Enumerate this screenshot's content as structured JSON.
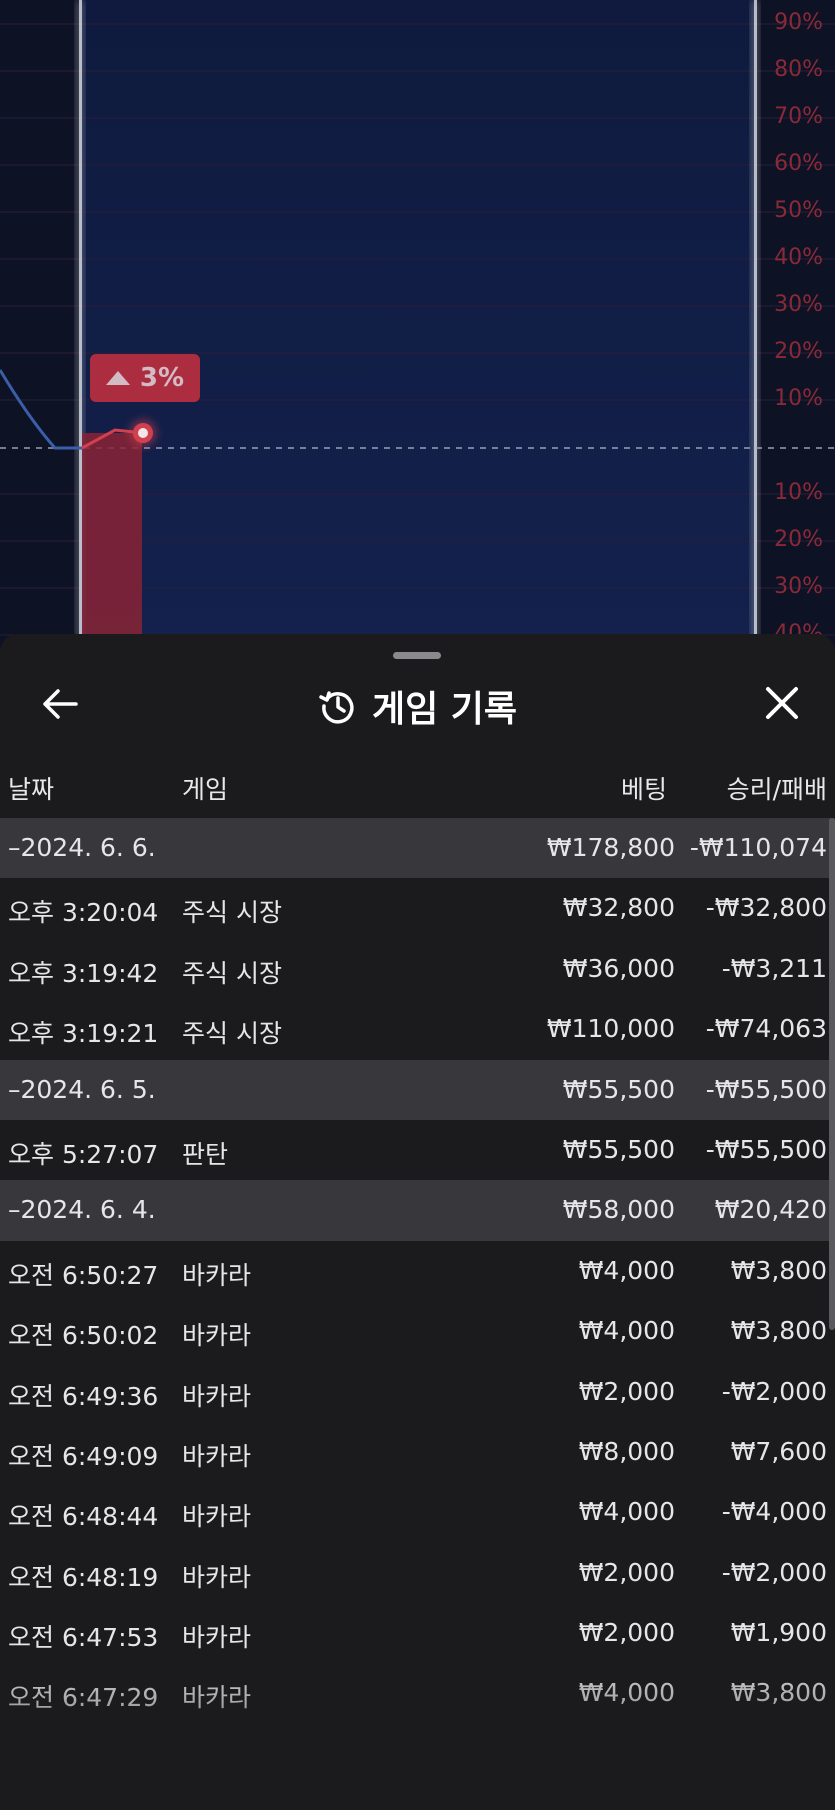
{
  "chart": {
    "percent_labels": [
      "90%",
      "80%",
      "70%",
      "60%",
      "50%",
      "40%",
      "30%",
      "20%",
      "10%",
      "10%",
      "20%",
      "30%",
      "40%"
    ],
    "change_badge": "3%",
    "accent_color": "#c8303f"
  },
  "sheet": {
    "title": "게임 기록",
    "title_icon": "history-icon",
    "back_icon": "arrow-left-icon",
    "close_icon": "close-icon",
    "columns": {
      "date": "날짜",
      "game": "게임",
      "bet": "베팅",
      "result": "승리/패배"
    },
    "rows": [
      {
        "type": "group",
        "date": "–2024. 6. 6.",
        "game": "",
        "bet": "₩178,800",
        "result": "-₩110,074"
      },
      {
        "type": "item",
        "date": "오후 3:20:04",
        "game": "주식 시장",
        "bet": "₩32,800",
        "result": "-₩32,800"
      },
      {
        "type": "item",
        "date": "오후 3:19:42",
        "game": "주식 시장",
        "bet": "₩36,000",
        "result": "-₩3,211"
      },
      {
        "type": "item",
        "date": "오후 3:19:21",
        "game": "주식 시장",
        "bet": "₩110,000",
        "result": "-₩74,063"
      },
      {
        "type": "group",
        "date": "–2024. 6. 5.",
        "game": "",
        "bet": "₩55,500",
        "result": "-₩55,500"
      },
      {
        "type": "item",
        "date": "오후 5:27:07",
        "game": "판탄",
        "bet": "₩55,500",
        "result": "-₩55,500"
      },
      {
        "type": "group",
        "date": "–2024. 6. 4.",
        "game": "",
        "bet": "₩58,000",
        "result": "₩20,420"
      },
      {
        "type": "item",
        "date": "오전 6:50:27",
        "game": "바카라",
        "bet": "₩4,000",
        "result": "₩3,800"
      },
      {
        "type": "item",
        "date": "오전 6:50:02",
        "game": "바카라",
        "bet": "₩4,000",
        "result": "₩3,800"
      },
      {
        "type": "item",
        "date": "오전 6:49:36",
        "game": "바카라",
        "bet": "₩2,000",
        "result": "-₩2,000"
      },
      {
        "type": "item",
        "date": "오전 6:49:09",
        "game": "바카라",
        "bet": "₩8,000",
        "result": "₩7,600"
      },
      {
        "type": "item",
        "date": "오전 6:48:44",
        "game": "바카라",
        "bet": "₩4,000",
        "result": "-₩4,000"
      },
      {
        "type": "item",
        "date": "오전 6:48:19",
        "game": "바카라",
        "bet": "₩2,000",
        "result": "-₩2,000"
      },
      {
        "type": "item",
        "date": "오전 6:47:53",
        "game": "바카라",
        "bet": "₩2,000",
        "result": "₩1,900"
      },
      {
        "type": "item",
        "date": "오전 6:47:29",
        "game": "바카라",
        "bet": "₩4,000",
        "result": "₩3,800"
      }
    ]
  }
}
